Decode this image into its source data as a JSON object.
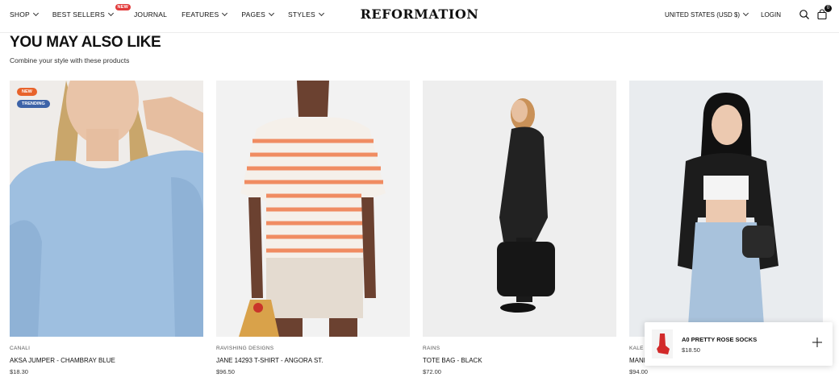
{
  "nav": {
    "items": [
      {
        "label": "SHOP",
        "chevron": true
      },
      {
        "label": "BEST SELLERS",
        "chevron": true,
        "badge": "NEW"
      },
      {
        "label": "JOURNAL",
        "chevron": false
      },
      {
        "label": "FEATURES",
        "chevron": true
      },
      {
        "label": "PAGES",
        "chevron": true
      },
      {
        "label": "STYLES",
        "chevron": true
      }
    ]
  },
  "brand": {
    "logo": "REFORMATION"
  },
  "header_right": {
    "currency": "UNITED STATES (USD $)",
    "login": "LOGIN",
    "cart_count": "0",
    "icons": [
      "search-icon",
      "cart-icon"
    ]
  },
  "section": {
    "title": "YOU MAY ALSO LIKE",
    "subtitle": "Combine your style with these products"
  },
  "products": [
    {
      "brand": "CANALI",
      "name": "AKSA JUMPER - CHAMBRAY BLUE",
      "price": "$18.30",
      "tags": [
        "NEW",
        "TRENDING"
      ]
    },
    {
      "brand": "RAVISHING DESIGNS",
      "name": "JANE 14293 T-SHIRT - ANGORA ST.",
      "price": "$96.50",
      "tags": []
    },
    {
      "brand": "RAINS",
      "name": "TOTE BAG - BLACK",
      "price": "$72.00",
      "tags": []
    },
    {
      "brand": "KALE",
      "name": "MANF",
      "price": "$94.00",
      "tags": []
    }
  ],
  "popup": {
    "title": "A0 PRETTY ROSE SOCKS",
    "price": "$18.50"
  },
  "colors": {
    "new_tag": "#e8632b",
    "trending_tag": "#3d63a8",
    "badge": "#e23b3b"
  }
}
